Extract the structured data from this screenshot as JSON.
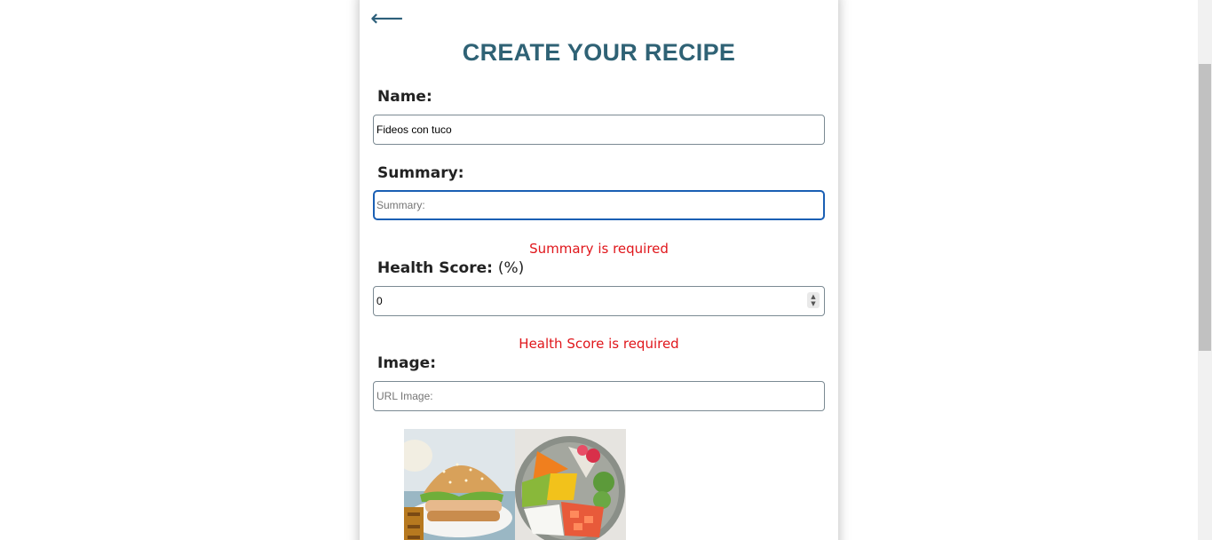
{
  "header": {
    "back_symbol": "⟵",
    "title": "CREATE YOUR RECIPE"
  },
  "form": {
    "name": {
      "label": "Name:",
      "value": "Fideos con tuco"
    },
    "summary": {
      "label": "Summary:",
      "placeholder": "Summary:",
      "value": "",
      "error": "Summary is required"
    },
    "health_score": {
      "label": "Health Score:",
      "unit": "(%)",
      "value": "0",
      "error": "Health Score is required"
    },
    "image": {
      "label": "Image:",
      "placeholder": "URL Image:",
      "value": ""
    }
  },
  "gallery": [
    {
      "icon": "burger-photo"
    },
    {
      "icon": "poke-bowl-photo"
    }
  ],
  "colors": {
    "title": "#2f6275",
    "error": "#e0161b",
    "focus": "#1a5fb4"
  }
}
